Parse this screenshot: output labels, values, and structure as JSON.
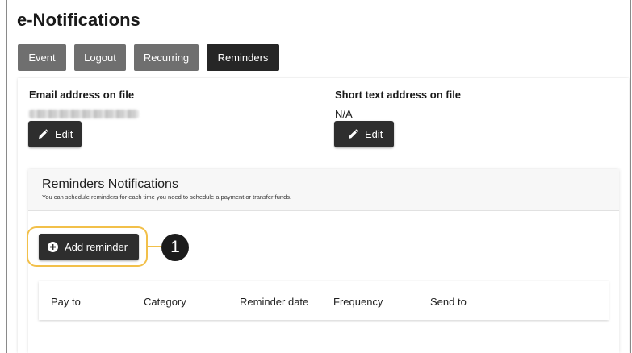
{
  "page": {
    "title": "e-Notifications"
  },
  "tabs": [
    {
      "label": "Event"
    },
    {
      "label": "Logout"
    },
    {
      "label": "Recurring"
    },
    {
      "label": "Reminders"
    }
  ],
  "contact": {
    "email_label": "Email address on file",
    "email_value": "",
    "sms_label": "Short text address on file",
    "sms_value": "N/A",
    "edit_label": "Edit"
  },
  "reminders": {
    "title": "Reminders Notifications",
    "subtitle": "You can schedule reminders for each time you need to schedule a payment or transfer funds.",
    "add_label": "Add reminder",
    "callout_number": "1",
    "columns": [
      "Pay to",
      "Category",
      "Reminder date",
      "Frequency",
      "Send to"
    ]
  },
  "icons": {
    "edit": "pencil-icon",
    "add": "plus-circle-icon"
  },
  "colors": {
    "tab_inactive": "#6f6f6f",
    "tab_active": "#262626",
    "button": "#2e2e2e",
    "highlight": "#f2c04a"
  }
}
